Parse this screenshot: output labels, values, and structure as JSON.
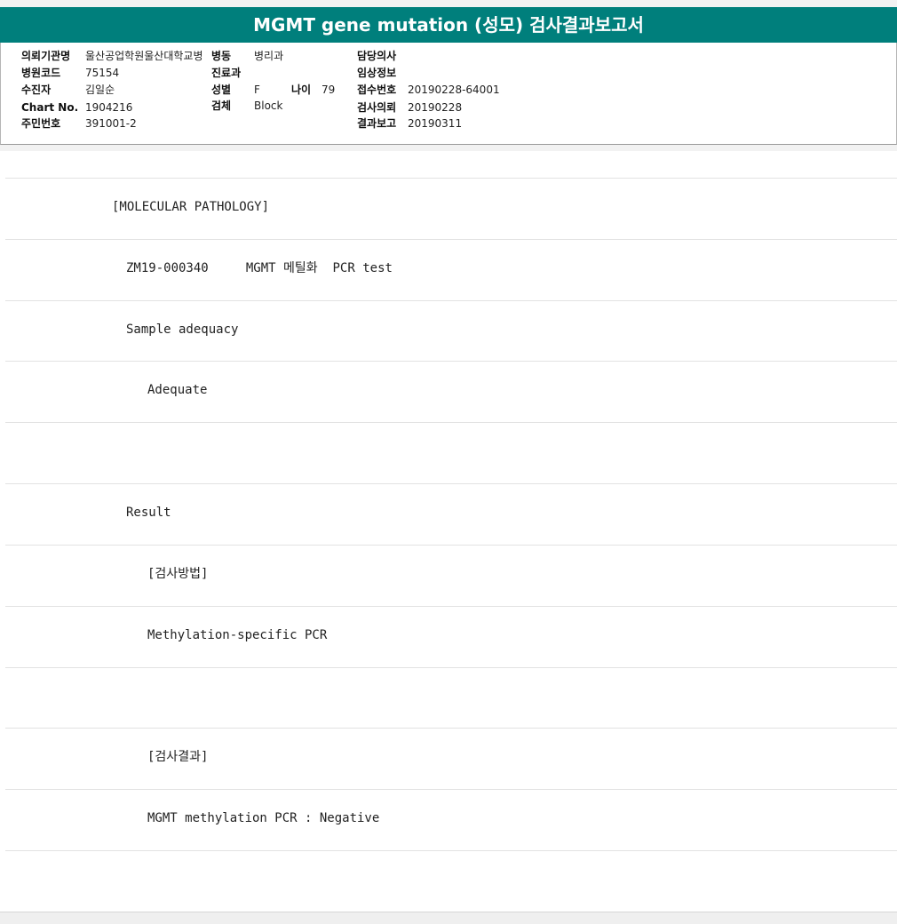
{
  "title": "MGMT gene mutation (성모) 검사결과보고서",
  "header": {
    "requesting_institution_label": "의뢰기관명",
    "requesting_institution": "울산공업학원울산대학교병",
    "ward_label": "병동",
    "ward": "병리과",
    "attending_doctor_label": "담당의사",
    "attending_doctor": "",
    "hospital_code_label": "병원코드",
    "hospital_code": "75154",
    "department_label": "진료과",
    "department": "",
    "clinical_info_label": "임상정보",
    "clinical_info": "",
    "patient_label": "수진자",
    "patient": "김일순",
    "sex_label": "성별",
    "sex": "F",
    "age_label": "나이",
    "age": "79",
    "receipt_no_label": "접수번호",
    "receipt_no": "20190228-64001",
    "chart_no_label": "Chart No.",
    "chart_no": "1904216",
    "specimen_label": "검체",
    "specimen": "Block",
    "request_date_label": "검사의뢰",
    "request_date": "20190228",
    "resident_no_label": "주민번호",
    "resident_no": "391001-2",
    "report_date_label": "결과보고",
    "report_date": "20190311"
  },
  "report_lines": [
    "",
    "[MOLECULAR PATHOLOGY]",
    "ZM19-000340     MGMT 메틸화  PCR test",
    "Sample adequacy",
    "Adequate",
    "",
    "Result",
    "[검사방법]",
    "Methylation-specific PCR",
    "",
    "[검사결과]",
    "MGMT methylation PCR : Negative",
    ""
  ],
  "colors": {
    "title_bar": "#007f7c",
    "title_text": "#ffffff"
  }
}
